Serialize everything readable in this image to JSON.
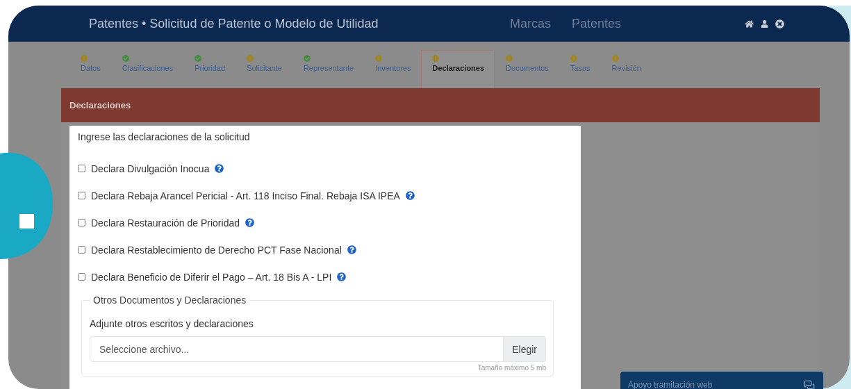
{
  "header": {
    "title": "Patentes • Solicitud de Patente o Modelo de Utilidad",
    "nav": [
      {
        "label": "Marcas"
      },
      {
        "label": "Patentes"
      }
    ]
  },
  "steps": [
    {
      "label": "Datos",
      "complete": false,
      "selected": false
    },
    {
      "label": "Clasificaciones",
      "complete": true,
      "selected": false
    },
    {
      "label": "Prioridad",
      "complete": true,
      "selected": false
    },
    {
      "label": "Solicitante",
      "complete": false,
      "selected": false
    },
    {
      "label": "Representante",
      "complete": true,
      "selected": false
    },
    {
      "label": "Inventores",
      "complete": false,
      "selected": false
    },
    {
      "label": "Declaraciones",
      "complete": false,
      "selected": true
    },
    {
      "label": "Documentos",
      "complete": false,
      "selected": false
    },
    {
      "label": "Tasas",
      "complete": false,
      "selected": false
    },
    {
      "label": "Revisión",
      "complete": false,
      "selected": false
    }
  ],
  "panel": {
    "title": "Declaraciones",
    "intro": "Ingrese las declaraciones de la solicitud",
    "declarations": [
      {
        "label": "Declara Divulgación Inocua",
        "checked": false
      },
      {
        "label": "Declara Rebaja Arancel Pericial - Art. 118 Inciso Final. Rebaja ISA IPEA",
        "checked": false
      },
      {
        "label": "Declara Restauración de Prioridad",
        "checked": false
      },
      {
        "label": "Declara Restablecimiento de Derecho PCT Fase Nacional",
        "checked": false
      },
      {
        "label": "Declara Beneficio de Diferir el Pago – Art. 18 Bis A - LPI",
        "checked": false
      }
    ],
    "other": {
      "legend": "Otros Documentos y Declaraciones",
      "label": "Adjunte otros escritos y declaraciones",
      "placeholder": "Seleccione archivo...",
      "button": "Elegir",
      "hint": "Tamaño máximo 5 mb"
    }
  },
  "chat": {
    "label": "Apoyo tramitación web"
  }
}
